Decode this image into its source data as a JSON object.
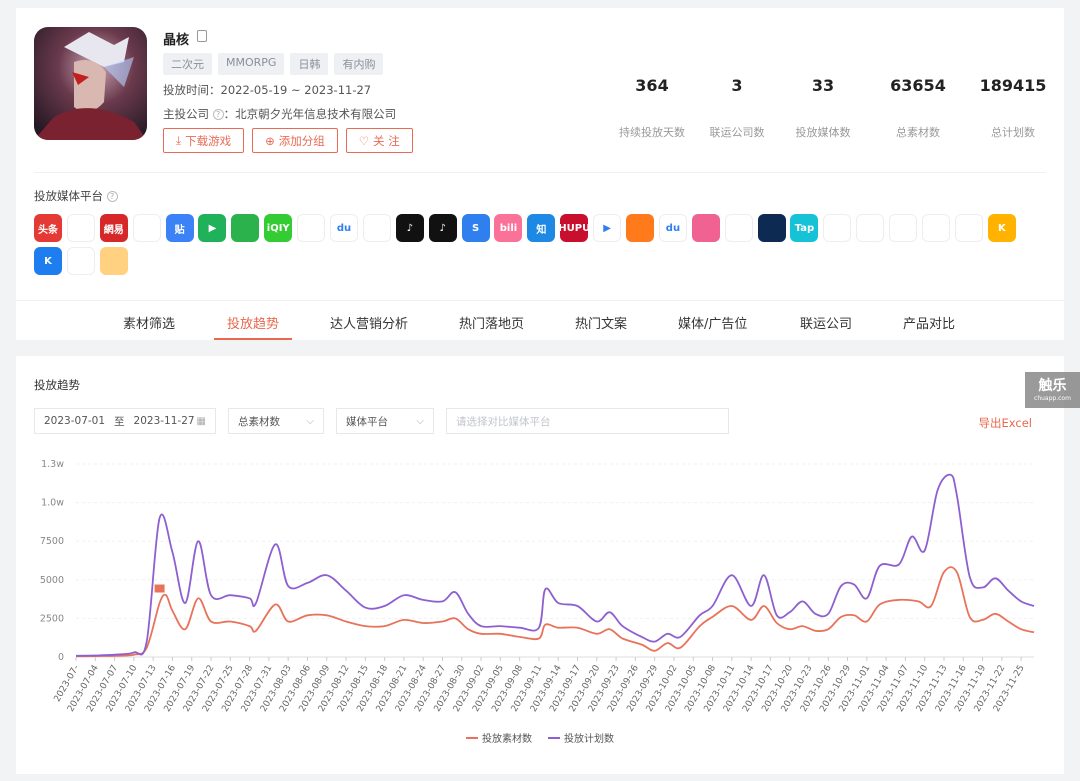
{
  "game": {
    "name": "晶核",
    "tags": [
      "二次元",
      "MMORPG",
      "日韩",
      "有内购"
    ],
    "period_label": "投放时间：",
    "period_value": "2022-05-19 ~ 2023-11-27",
    "company_label": "主投公司",
    "company_sep": "：",
    "company_value": "北京朝夕光年信息技术有限公司",
    "buttons": [
      "下载游戏",
      "添加分组",
      "关 注"
    ]
  },
  "stats": [
    {
      "value": "364",
      "label": "持续投放天数"
    },
    {
      "value": "3",
      "label": "联运公司数"
    },
    {
      "value": "33",
      "label": "投放媒体数"
    },
    {
      "value": "63654",
      "label": "总素材数"
    },
    {
      "value": "189415",
      "label": "总计划数"
    }
  ],
  "platforms": {
    "title": "投放媒体平台",
    "icons": [
      {
        "name": "toutiao-icon",
        "text": "头条",
        "bg": "#e53935"
      },
      {
        "name": "tencent-video-icon",
        "text": "",
        "bg": "#ffffff"
      },
      {
        "name": "netease-news-icon",
        "text": "網易",
        "bg": "#d62828"
      },
      {
        "name": "deer-icon",
        "text": "",
        "bg": "#ffffff"
      },
      {
        "name": "tieba-icon",
        "text": "贴",
        "bg": "#3b82f6"
      },
      {
        "name": "play-arrow-icon",
        "text": "▶",
        "bg": "#20b25a"
      },
      {
        "name": "wechat-icon",
        "text": "",
        "bg": "#2bb24c"
      },
      {
        "name": "iqiyi-icon",
        "text": "iQIY",
        "bg": "#33cc33"
      },
      {
        "name": "weibo-icon",
        "text": "",
        "bg": "#ffffff"
      },
      {
        "name": "baidu-paw-icon",
        "text": "du",
        "bg": "#ffffff"
      },
      {
        "name": "red-play-icon",
        "text": "",
        "bg": "#ffffff"
      },
      {
        "name": "douyin-icon",
        "text": "♪",
        "bg": "#111111"
      },
      {
        "name": "douyin-lite-icon",
        "text": "♪",
        "bg": "#111111"
      },
      {
        "name": "browser-s-icon",
        "text": "S",
        "bg": "#2f7fee"
      },
      {
        "name": "bilibili-icon",
        "text": "bili",
        "bg": "#fb7299"
      },
      {
        "name": "zhihu-icon",
        "text": "知",
        "bg": "#1e88e5"
      },
      {
        "name": "hupu-icon",
        "text": "HUPU",
        "bg": "#c8102e"
      },
      {
        "name": "colorful-play-icon",
        "text": "▶",
        "bg": "#ffffff"
      },
      {
        "name": "kuaishou-icon",
        "text": "",
        "bg": "#ff7a1a"
      },
      {
        "name": "baidu-icon",
        "text": "du",
        "bg": "#ffffff"
      },
      {
        "name": "pink-face-icon",
        "text": "",
        "bg": "#f06292"
      },
      {
        "name": "round-logo-icon",
        "text": "",
        "bg": "#ffffff"
      },
      {
        "name": "whale-icon",
        "text": "",
        "bg": "#0d2b52"
      },
      {
        "name": "taptap-icon",
        "text": "Tap",
        "bg": "#16c2d5"
      },
      {
        "name": "qq-penguin-icon",
        "text": "",
        "bg": "#ffffff"
      },
      {
        "name": "arc-icon",
        "text": "",
        "bg": "#ffffff"
      },
      {
        "name": "red-game-icon",
        "text": "",
        "bg": "#ffffff"
      },
      {
        "name": "globe-icon",
        "text": "",
        "bg": "#ffffff"
      },
      {
        "name": "music-note-icon",
        "text": "",
        "bg": "#ffffff"
      },
      {
        "name": "k-yellow-icon",
        "text": "K",
        "bg": "#ffb300"
      },
      {
        "name": "k-blue-icon",
        "text": "K",
        "bg": "#1e7ef0"
      },
      {
        "name": "blue-chat-icon",
        "text": "",
        "bg": "#ffffff"
      },
      {
        "name": "cartoon-face-icon",
        "text": "",
        "bg": "#ffd180"
      }
    ]
  },
  "tabs": [
    {
      "label": "素材筛选"
    },
    {
      "label": "投放趋势"
    },
    {
      "label": "达人营销分析"
    },
    {
      "label": "热门落地页"
    },
    {
      "label": "热门文案"
    },
    {
      "label": "媒体/广告位"
    },
    {
      "label": "联运公司"
    },
    {
      "label": "产品对比"
    }
  ],
  "active_tab": "投放趋势",
  "trend": {
    "title": "投放趋势",
    "date_start": "2023-07-01",
    "date_sep": "至",
    "date_end": "2023-11-27",
    "metric_select": "总素材数",
    "platform_select": "媒体平台",
    "compare_placeholder": "请选择对比媒体平台",
    "export_label": "导出Excel"
  },
  "colors": {
    "accent": "#e7694f",
    "series_material": "#e8735a",
    "series_plan": "#8e5fd0"
  },
  "watermark": {
    "line1": "触乐",
    "line2": "chuapp.com"
  },
  "chart_data": {
    "type": "line",
    "x_start": "2023-07-01",
    "x_end": "2023-11-27",
    "tick_labels": [
      "2023-07-01",
      "2023-07-04",
      "2023-07-07",
      "2023-07-10",
      "2023-07-13",
      "2023-07-16",
      "2023-07-19",
      "2023-07-22",
      "2023-07-25",
      "2023-07-28",
      "2023-07-31",
      "2023-08-03",
      "2023-08-06",
      "2023-08-09",
      "2023-08-12",
      "2023-08-15",
      "2023-08-18",
      "2023-08-21",
      "2023-08-24",
      "2023-08-27",
      "2023-08-30",
      "2023-09-02",
      "2023-09-05",
      "2023-09-08",
      "2023-09-11",
      "2023-09-14",
      "2023-09-17",
      "2023-09-20",
      "2023-09-23",
      "2023-09-26",
      "2023-09-29",
      "2023-10-02",
      "2023-10-05",
      "2023-10-08",
      "2023-10-11",
      "2023-10-14",
      "2023-10-17",
      "2023-10-20",
      "2023-10-23",
      "2023-10-26",
      "2023-10-29",
      "2023-11-01",
      "2023-11-04",
      "2023-11-07",
      "2023-11-10",
      "2023-11-13",
      "2023-11-16",
      "2023-11-19",
      "2023-11-22",
      "2023-11-25"
    ],
    "tick_display": [
      "2023-07-",
      "2023-07-04",
      "2023-07-07",
      "2023-07-10",
      "2023-07-13",
      "2023-07-16",
      "2023-07-19",
      "2023-07-22",
      "2023-07-25",
      "2023-07-28",
      "2023-07-31",
      "2023-08-03",
      "2023-08-06",
      "2023-08-09",
      "2023-08-12",
      "2023-08-15",
      "2023-08-18",
      "2023-08-21",
      "2023-08-24",
      "2023-08-27",
      "2023-08-30",
      "2023-09-02",
      "2023-09-05",
      "2023-09-08",
      "2023-09-11",
      "2023-09-14",
      "2023-09-17",
      "2023-09-20",
      "2023-09-23",
      "2023-09-26",
      "2023-09-29",
      "2023-10-02",
      "2023-10-05",
      "2023-10-08",
      "2023-10-11",
      "2023-10-14",
      "2023-10-17",
      "2023-10-20",
      "2023-10-23",
      "2023-10-26",
      "2023-10-29",
      "2023-11-01",
      "2023-11-04",
      "2023-11-07",
      "2023-11-10",
      "2023-11-13",
      "2023-11-16",
      "2023-11-19",
      "2023-11-22",
      "2023-11-25"
    ],
    "y_ticks": [
      {
        "value": 0,
        "label": "0"
      },
      {
        "value": 2500,
        "label": "2500"
      },
      {
        "value": 5000,
        "label": "5000"
      },
      {
        "value": 7500,
        "label": "7500"
      },
      {
        "value": 10000,
        "label": "1.0w"
      },
      {
        "value": 12500,
        "label": "1.3w"
      }
    ],
    "ylim": [
      0,
      12500
    ],
    "legend_position": "bottom-center",
    "series": [
      {
        "name": "投放素材数",
        "color": "#e8735a",
        "points": [
          [
            "2023-07-01",
            50
          ],
          [
            "2023-07-04",
            60
          ],
          [
            "2023-07-07",
            80
          ],
          [
            "2023-07-10",
            150
          ],
          [
            "2023-07-12",
            600
          ],
          [
            "2023-07-14",
            3500
          ],
          [
            "2023-07-15",
            4000
          ],
          [
            "2023-07-16",
            3000
          ],
          [
            "2023-07-18",
            1800
          ],
          [
            "2023-07-20",
            3800
          ],
          [
            "2023-07-22",
            2300
          ],
          [
            "2023-07-25",
            2300
          ],
          [
            "2023-07-28",
            2000
          ],
          [
            "2023-07-29",
            1700
          ],
          [
            "2023-08-01",
            3400
          ],
          [
            "2023-08-03",
            2300
          ],
          [
            "2023-08-06",
            2700
          ],
          [
            "2023-08-09",
            2700
          ],
          [
            "2023-08-12",
            2300
          ],
          [
            "2023-08-15",
            2000
          ],
          [
            "2023-08-18",
            2000
          ],
          [
            "2023-08-21",
            2400
          ],
          [
            "2023-08-24",
            2200
          ],
          [
            "2023-08-27",
            2300
          ],
          [
            "2023-08-29",
            2500
          ],
          [
            "2023-08-31",
            1800
          ],
          [
            "2023-09-02",
            1500
          ],
          [
            "2023-09-05",
            1500
          ],
          [
            "2023-09-08",
            1300
          ],
          [
            "2023-09-11",
            1200
          ],
          [
            "2023-09-12",
            2100
          ],
          [
            "2023-09-14",
            1900
          ],
          [
            "2023-09-17",
            1900
          ],
          [
            "2023-09-20",
            1500
          ],
          [
            "2023-09-22",
            1800
          ],
          [
            "2023-09-24",
            1200
          ],
          [
            "2023-09-27",
            800
          ],
          [
            "2023-09-29",
            400
          ],
          [
            "2023-10-01",
            900
          ],
          [
            "2023-10-03",
            600
          ],
          [
            "2023-10-06",
            2000
          ],
          [
            "2023-10-08",
            2600
          ],
          [
            "2023-10-11",
            3300
          ],
          [
            "2023-10-14",
            2400
          ],
          [
            "2023-10-16",
            3300
          ],
          [
            "2023-10-18",
            2200
          ],
          [
            "2023-10-20",
            1800
          ],
          [
            "2023-10-22",
            2000
          ],
          [
            "2023-10-24",
            1700
          ],
          [
            "2023-10-26",
            1800
          ],
          [
            "2023-10-28",
            2600
          ],
          [
            "2023-10-30",
            2700
          ],
          [
            "2023-11-01",
            2300
          ],
          [
            "2023-11-03",
            3400
          ],
          [
            "2023-11-06",
            3700
          ],
          [
            "2023-11-09",
            3600
          ],
          [
            "2023-11-11",
            3300
          ],
          [
            "2023-11-13",
            5500
          ],
          [
            "2023-11-15",
            5500
          ],
          [
            "2023-11-17",
            2600
          ],
          [
            "2023-11-19",
            2400
          ],
          [
            "2023-11-21",
            2800
          ],
          [
            "2023-11-23",
            2300
          ],
          [
            "2023-11-25",
            1800
          ],
          [
            "2023-11-27",
            1600
          ]
        ]
      },
      {
        "name": "投放计划数",
        "color": "#8e5fd0",
        "points": [
          [
            "2023-07-01",
            80
          ],
          [
            "2023-07-04",
            100
          ],
          [
            "2023-07-07",
            150
          ],
          [
            "2023-07-10",
            300
          ],
          [
            "2023-07-12",
            1000
          ],
          [
            "2023-07-14",
            9000
          ],
          [
            "2023-07-16",
            6800
          ],
          [
            "2023-07-18",
            3500
          ],
          [
            "2023-07-20",
            7500
          ],
          [
            "2023-07-22",
            4000
          ],
          [
            "2023-07-25",
            4000
          ],
          [
            "2023-07-28",
            3800
          ],
          [
            "2023-07-29",
            3500
          ],
          [
            "2023-08-01",
            7300
          ],
          [
            "2023-08-03",
            4600
          ],
          [
            "2023-08-06",
            4800
          ],
          [
            "2023-08-09",
            5300
          ],
          [
            "2023-08-12",
            4300
          ],
          [
            "2023-08-15",
            3200
          ],
          [
            "2023-08-18",
            3300
          ],
          [
            "2023-08-21",
            4000
          ],
          [
            "2023-08-24",
            3700
          ],
          [
            "2023-08-27",
            3600
          ],
          [
            "2023-08-29",
            4200
          ],
          [
            "2023-08-31",
            2800
          ],
          [
            "2023-09-02",
            2000
          ],
          [
            "2023-09-05",
            2000
          ],
          [
            "2023-09-08",
            1900
          ],
          [
            "2023-09-11",
            1900
          ],
          [
            "2023-09-12",
            4400
          ],
          [
            "2023-09-14",
            3500
          ],
          [
            "2023-09-17",
            3300
          ],
          [
            "2023-09-20",
            2300
          ],
          [
            "2023-09-22",
            2900
          ],
          [
            "2023-09-24",
            2000
          ],
          [
            "2023-09-27",
            1300
          ],
          [
            "2023-09-29",
            1000
          ],
          [
            "2023-10-01",
            1500
          ],
          [
            "2023-10-03",
            1300
          ],
          [
            "2023-10-06",
            2700
          ],
          [
            "2023-10-08",
            3300
          ],
          [
            "2023-10-11",
            5300
          ],
          [
            "2023-10-14",
            3300
          ],
          [
            "2023-10-16",
            5300
          ],
          [
            "2023-10-18",
            2700
          ],
          [
            "2023-10-20",
            2900
          ],
          [
            "2023-10-22",
            3600
          ],
          [
            "2023-10-24",
            2800
          ],
          [
            "2023-10-26",
            2800
          ],
          [
            "2023-10-28",
            4600
          ],
          [
            "2023-10-30",
            4700
          ],
          [
            "2023-11-01",
            3800
          ],
          [
            "2023-11-03",
            5900
          ],
          [
            "2023-11-06",
            6000
          ],
          [
            "2023-11-08",
            7800
          ],
          [
            "2023-11-10",
            6900
          ],
          [
            "2023-11-12",
            10800
          ],
          [
            "2023-11-14",
            11800
          ],
          [
            "2023-11-15",
            10500
          ],
          [
            "2023-11-17",
            5200
          ],
          [
            "2023-11-19",
            4500
          ],
          [
            "2023-11-21",
            5100
          ],
          [
            "2023-11-23",
            4300
          ],
          [
            "2023-11-25",
            3600
          ],
          [
            "2023-11-27",
            3300
          ]
        ]
      }
    ],
    "highlight_point": {
      "date": "2023-07-14",
      "value": 4500
    }
  }
}
